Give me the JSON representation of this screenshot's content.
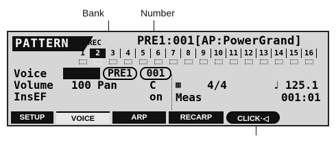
{
  "callouts": {
    "bank": "Bank",
    "number": "Number"
  },
  "lcd": {
    "mode": "PATTERN",
    "rec": "REC",
    "header_info": "PRE1:001[AP:PowerGrand]",
    "tracks": [
      "1",
      "2",
      "3",
      "4",
      "5",
      "6",
      "7",
      "8",
      "9",
      "10",
      "11",
      "12",
      "13",
      "14",
      "15",
      "16"
    ],
    "active_track_index": 1,
    "params": {
      "voice_label": "Voice",
      "bank": "PRE1",
      "number": "001",
      "volume_label": "Volume",
      "volume_value": "100",
      "pan_label": "Pan",
      "pan_value": "C",
      "insef_label": "InsEF",
      "insef_value": "on"
    },
    "right": {
      "time_sig": "4/4",
      "tempo": "125.1",
      "meas_label": "Meas",
      "meas_value": "001:01"
    },
    "tabs": [
      "SETUP",
      "VOICE",
      "ARP",
      "RECARP",
      "CLICK"
    ]
  }
}
